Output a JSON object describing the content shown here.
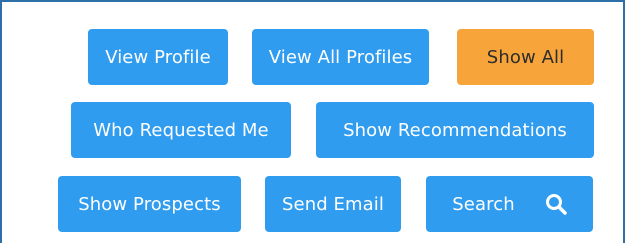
{
  "buttons": {
    "view_profile": "View Profile",
    "view_all_profiles": "View All Profiles",
    "show_all": "Show All",
    "who_requested_me": "Who Requested Me",
    "show_recommendations": "Show Recommendations",
    "show_prospects": "Show Prospects",
    "send_email": "Send Email",
    "search": "Search"
  },
  "icons": {
    "search": "search-icon"
  },
  "colors": {
    "primary": "#2f9cf0",
    "accent": "#f7a53a",
    "frame": "#2f6fa8"
  }
}
